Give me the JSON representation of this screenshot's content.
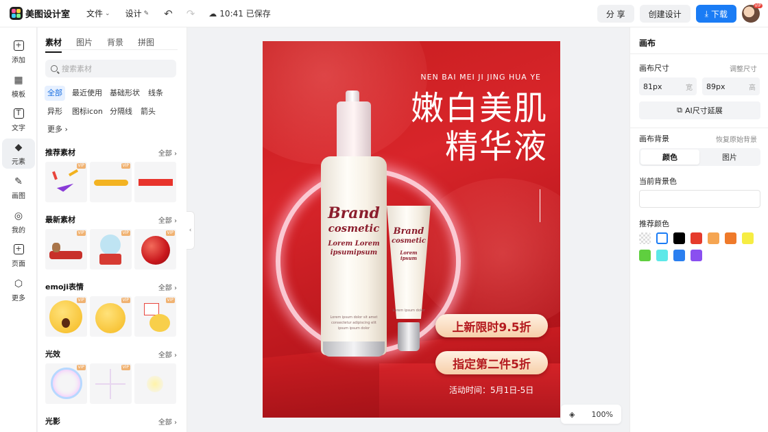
{
  "app": {
    "name": "美图设计室",
    "menu": {
      "file": "文件",
      "design": "设计"
    },
    "saved_status": "10:41 已保存",
    "share": "分 享",
    "create_design": "创建设计",
    "download": "下载",
    "vip": "VIP"
  },
  "rail": {
    "items": [
      {
        "label": "添加",
        "icon": "plus-icon"
      },
      {
        "label": "模板",
        "icon": "template-icon"
      },
      {
        "label": "文字",
        "icon": "text-icon"
      },
      {
        "label": "元素",
        "icon": "element-icon"
      },
      {
        "label": "画图",
        "icon": "draw-icon"
      },
      {
        "label": "我的",
        "icon": "user-icon"
      },
      {
        "label": "页面",
        "icon": "page-icon"
      },
      {
        "label": "更多",
        "icon": "cube-icon"
      }
    ]
  },
  "assets": {
    "tabs": [
      "素材",
      "图片",
      "背景",
      "拼图"
    ],
    "search_placeholder": "搜索素材",
    "chips": [
      "全部",
      "最近使用",
      "基础形状",
      "线条",
      "异形",
      "图标icon",
      "分隔线",
      "箭头",
      "更多"
    ],
    "all_label": "全部",
    "vip_badge": "VIP",
    "sections": [
      "推荐素材",
      "最新素材",
      "emoji表情",
      "光效",
      "光影"
    ]
  },
  "poster": {
    "subtitle": "NEN BAI MEI JI JING HUA YE",
    "title_line1": "嫩白美肌",
    "title_line2": "精华液",
    "bottle_brand": "Brand",
    "bottle_cosmetic": "cosmetic",
    "bottle_lorem": "Lorem Lorem",
    "bottle_ipsum": "ipsumipsum",
    "bottle_small": "Lorem ipsum dolor sit amet",
    "bottle_small2": "consectetur adipiscing elit",
    "bottle_small3": "ipsum ipsum dolor",
    "tube_brand": "Brand",
    "tube_cosmetic": "cosmetic",
    "tube_lorem": "Lorem",
    "tube_ipsum": "ipsum",
    "tube_small": "Lorem ipsum dolor",
    "promo1": "上新限时9.5折",
    "promo2": "指定第二件5折",
    "activity": "活动时间：5月1日-5日"
  },
  "zoom": "100%",
  "right": {
    "title": "画布",
    "size_label": "画布尺寸",
    "adjust_size": "调整尺寸",
    "width_value": "81px",
    "width_unit": "宽",
    "height_value": "89px",
    "height_unit": "高",
    "ai_extend": "AI尺寸延展",
    "bg_label": "画布背景",
    "restore_bg": "恢复原始背景",
    "bg_tabs": [
      "颜色",
      "图片"
    ],
    "current_bg": "当前背景色",
    "recommended": "推荐颜色",
    "swatches": [
      "transparent",
      "#ffffff",
      "#000000",
      "#e53b2c",
      "#f5a552",
      "#ef7a2a",
      "#f6ed43",
      "#5fcf3f",
      "#5de8e8",
      "#2b7ff0",
      "#8a4ff0"
    ]
  }
}
